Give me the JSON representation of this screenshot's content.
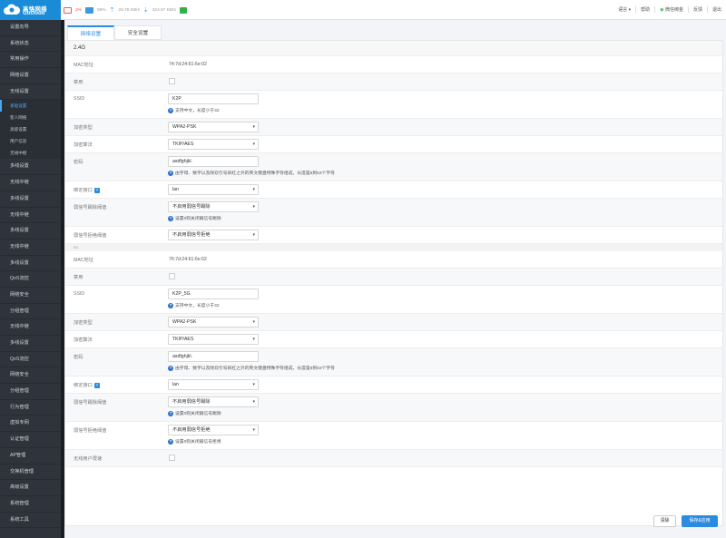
{
  "brand": {
    "name_cn": "高恪网络",
    "name_en": "Gocloud"
  },
  "stats": {
    "cpu": "2%",
    "memory": "55%",
    "up": "26.79 KB/s",
    "down": "324.57 KB/s"
  },
  "topnav": [
    "语言 ▾",
    "帮助",
    "微信绑金",
    "反馈",
    "退出"
  ],
  "sidebar": {
    "items": [
      {
        "label": "设置向导"
      },
      {
        "label": "系统状态"
      },
      {
        "label": "常用操作"
      },
      {
        "label": "网络设置"
      },
      {
        "label": "无线设置"
      },
      {
        "label": "基础设置",
        "sub": true,
        "active": true
      },
      {
        "label": "客人网络",
        "sub": true
      },
      {
        "label": "高级设置",
        "sub": true
      },
      {
        "label": "用户信息",
        "sub": true
      },
      {
        "label": "无线中继",
        "sub": true
      },
      {
        "label": "多线设置"
      },
      {
        "label": "无线中继"
      },
      {
        "label": "多线设置"
      },
      {
        "label": "无线中继"
      },
      {
        "label": "多线设置"
      },
      {
        "label": "无线中继"
      },
      {
        "label": "多线设置"
      },
      {
        "label": "QoS流控"
      },
      {
        "label": "网络安全"
      },
      {
        "label": "分组管理"
      },
      {
        "label": "无线中继"
      },
      {
        "label": "多线设置"
      },
      {
        "label": "QoS流控"
      },
      {
        "label": "网络安全"
      },
      {
        "label": "分组管理"
      },
      {
        "label": "行为管理"
      },
      {
        "label": "虚拟专网"
      },
      {
        "label": "认证管理"
      },
      {
        "label": "AP管理"
      },
      {
        "label": "交换机管理"
      },
      {
        "label": "高级设置"
      },
      {
        "label": "系统管理"
      },
      {
        "label": "系统工具"
      }
    ]
  },
  "tabs": [
    "网络设置",
    "安全设置"
  ],
  "band24": {
    "title": "2.4G",
    "mac_label": "MAC地址",
    "mac": "74:7d:24:61:6e:02",
    "disable_label": "禁用",
    "ssid_label": "SSID",
    "ssid": "K2P",
    "ssid_hint": "支持中文，长度小于32",
    "enc_type_label": "加密类型",
    "enc_type": "WPA2-PSK",
    "enc_algo_label": "加密算法",
    "enc_algo": "TKIP/AES",
    "pwd_label": "密码",
    "pwd": "asdfghjkl.",
    "pwd_hint": "由字母、数字以及除双引号斜杠之外的英文键盘特殊字符组成，长度是8到63个字符",
    "bind_label": "绑定接口",
    "bind": "lan",
    "weak_kick_label": "弱信号踢除阈值",
    "weak_kick": "不启用弱信号踢除",
    "weak_kick_hint": "设置0则关闭弱信号踢除",
    "weak_reject_label": "弱信号拒绝阈值",
    "weak_reject": "不启用弱信号拒绝"
  },
  "band5": {
    "title": "5G",
    "mac_label": "MAC地址",
    "mac": "76:7d:24:61:6e:02",
    "disable_label": "禁用",
    "ssid_label": "SSID",
    "ssid": "K2P_5G",
    "ssid_hint": "支持中文，长度小于32",
    "enc_type_label": "加密类型",
    "enc_type": "WPA2-PSK",
    "enc_algo_label": "加密算法",
    "enc_algo": "TKIP/AES",
    "pwd_label": "密码",
    "pwd": "asdfghjkl.",
    "pwd_hint": "由字母、数字以及除双引号斜杠之外的英文键盘特殊字符组成，长度是8到63个字符",
    "bind_label": "绑定接口",
    "bind": "lan",
    "weak_kick_label": "弱信号踢除阈值",
    "weak_kick": "不启用弱信号踢除",
    "weak_kick_hint": "设置0则关闭弱信号踢除",
    "weak_reject_label": "弱信号拒绝阈值",
    "weak_reject": "不启用弱信号拒绝",
    "weak_reject_hint": "设置0则关闭弱信号拒绝",
    "wireless_user_label": "无线用户限速"
  },
  "buttons": {
    "clear": "清除",
    "save": "保存&应用"
  },
  "colors": {
    "accent": "#2a8be0",
    "sidebar_bg": "#2f343c",
    "brand_bg": "#1a8bd6"
  }
}
